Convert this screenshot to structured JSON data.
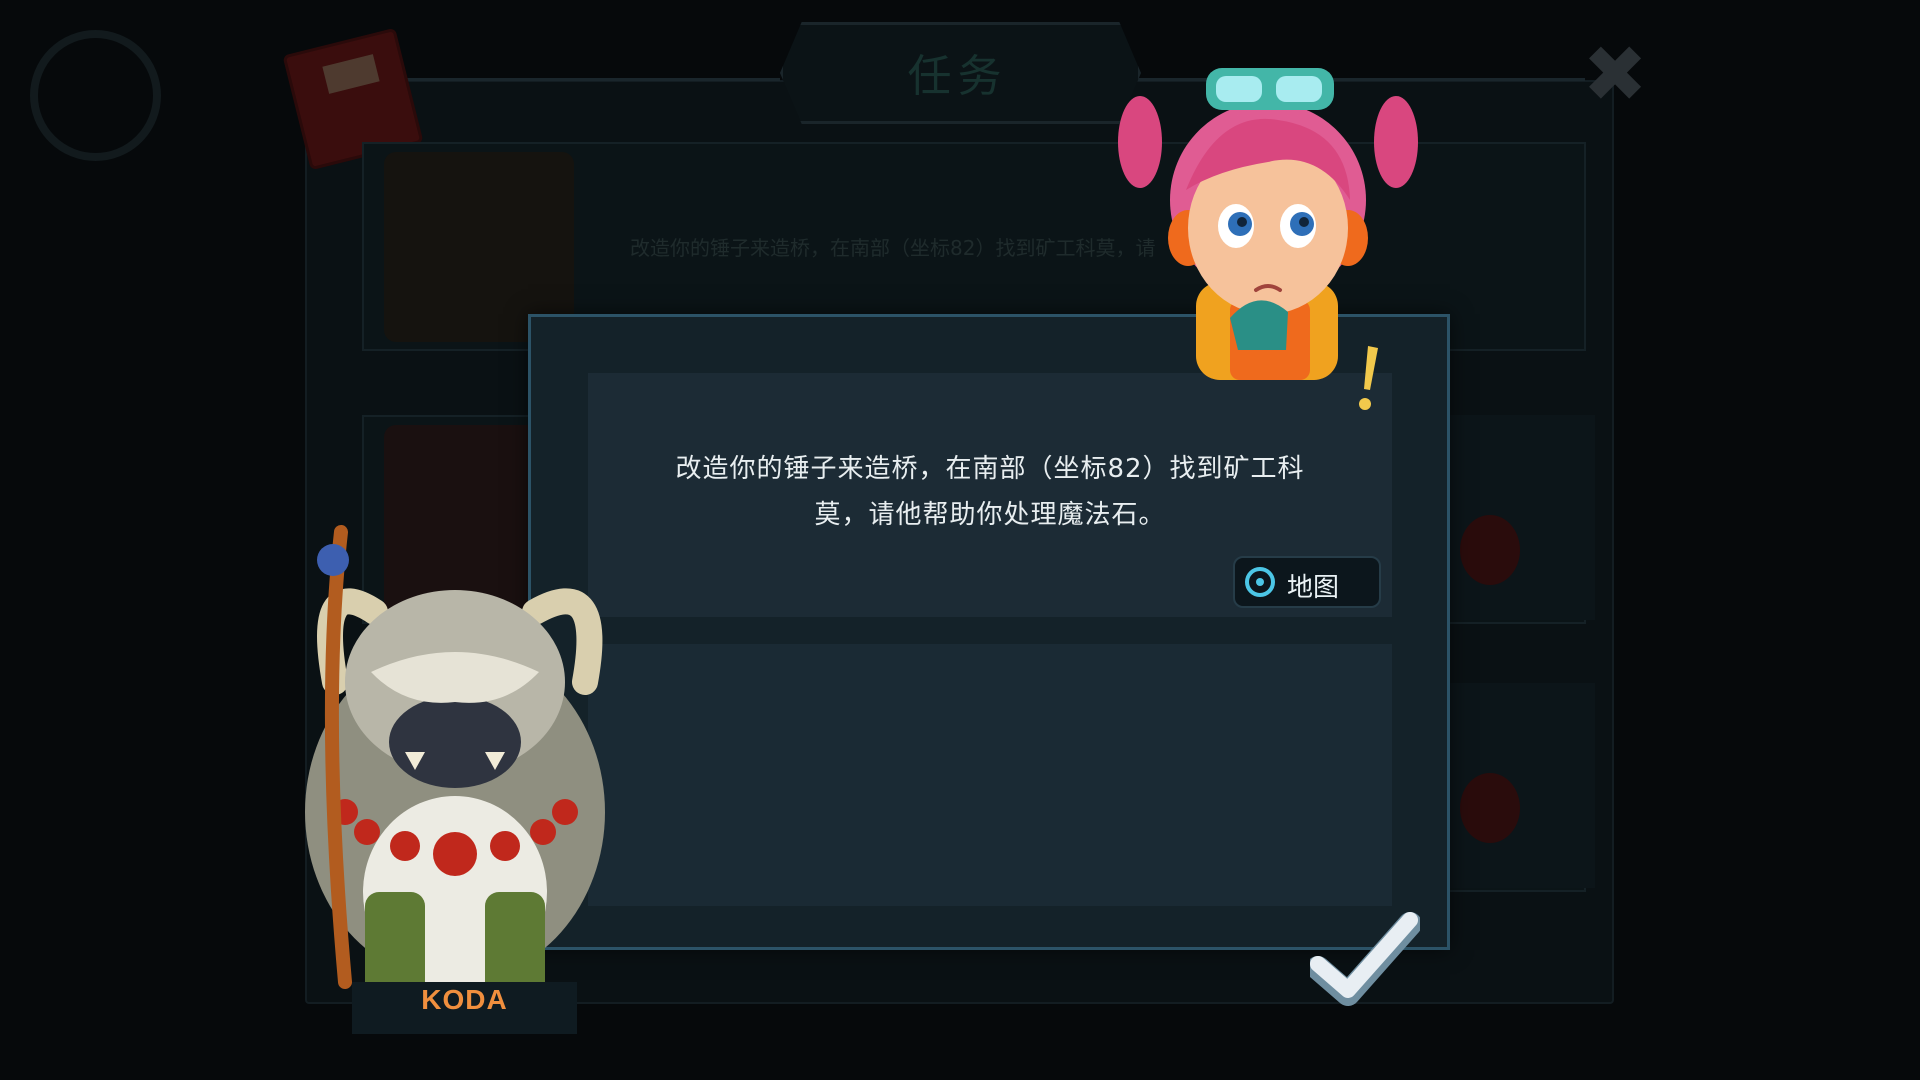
{
  "background_window": {
    "title": "任务",
    "first_quest_preview": "改造你的锤子来造桥，在南部（坐标82）找到矿工科莫，请",
    "first_quest_preview_tail": "。"
  },
  "dialog": {
    "quest_text_line1": "改造你的锤子来造桥，在南部（坐标82）找到矿工科",
    "quest_text_line2": "莫，请他帮助你处理魔法石。",
    "map_button_label": "地图",
    "confirm_icon": "checkmark-icon"
  },
  "speaker": {
    "name": "KODA"
  },
  "colors": {
    "speaker_name": "#f08f3e",
    "map_icon": "#4cc6e6",
    "panel_border": "#2c5367",
    "exclaim": "#f2c94c"
  }
}
